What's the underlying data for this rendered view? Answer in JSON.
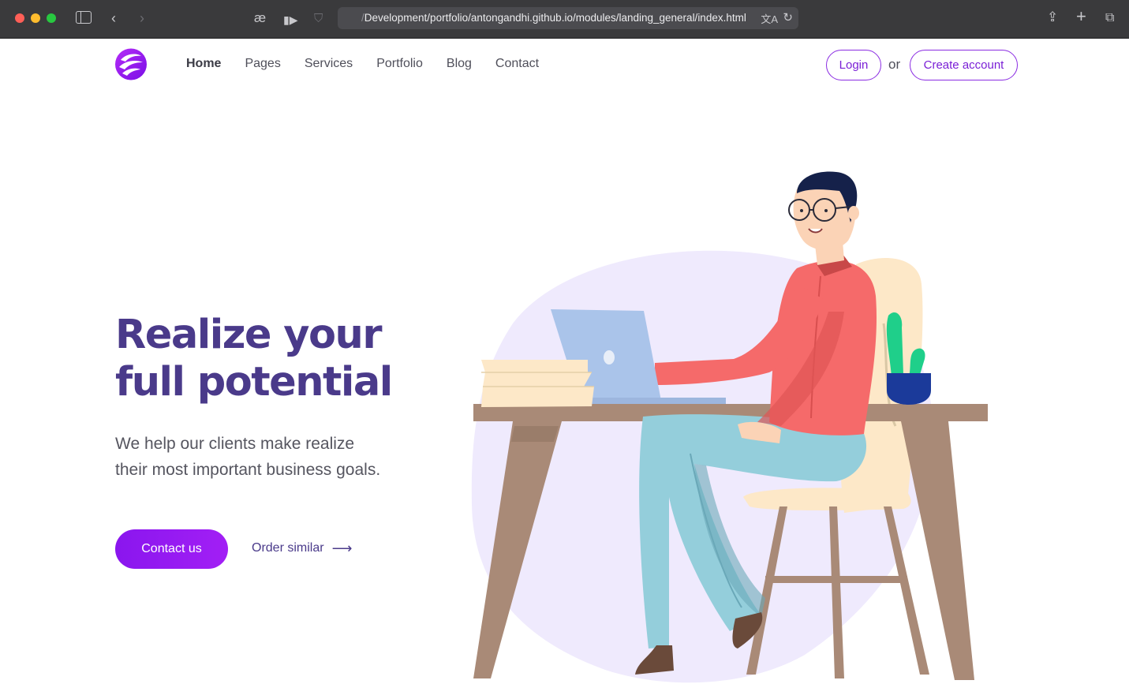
{
  "browser": {
    "address_prefix": "/",
    "address_url": "Development/portfolio/antongandhi.github.io/modules/landing_general/index.html"
  },
  "nav": {
    "links": [
      "Home",
      "Pages",
      "Services",
      "Portfolio",
      "Blog",
      "Contact"
    ],
    "login_label": "Login",
    "or_label": "or",
    "create_label": "Create account"
  },
  "hero": {
    "title": "Realize your full potential",
    "subtitle": "We help our clients make realize their most important business goals.",
    "contact_label": "Contact us",
    "order_label": "Order similar"
  },
  "colors": {
    "accent": "#8a16ee",
    "heading": "#4a3a8a",
    "blob": "#efeafd"
  }
}
